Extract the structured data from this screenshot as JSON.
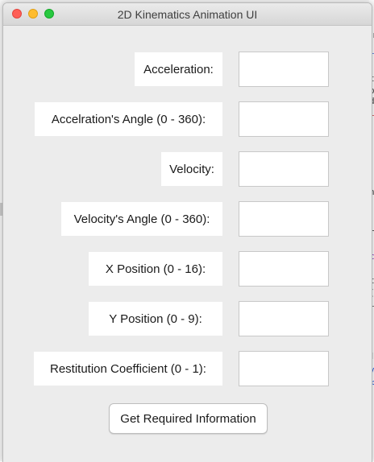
{
  "window": {
    "title": "2D Kinematics Animation UI"
  },
  "form": {
    "fields": [
      {
        "label": "Acceleration:",
        "value": ""
      },
      {
        "label": "Accelration's Angle (0 - 360):",
        "value": ""
      },
      {
        "label": "Velocity:",
        "value": ""
      },
      {
        "label": "Velocity's Angle (0 - 360):",
        "value": ""
      },
      {
        "label": "X Position (0 - 16):",
        "value": ""
      },
      {
        "label": "Y Position (0 - 9):",
        "value": ""
      },
      {
        "label": "Restitution Coefficient (0 - 1):",
        "value": ""
      }
    ],
    "submit_label": "Get Required Information"
  },
  "background_editor": {
    "fragments": [
      "er",
      "i",
      "t",
      "p",
      "d",
      "i",
      "n",
      "r",
      "c",
      "t",
      "(",
      "i",
      "M",
      "v",
      "<",
      "velo",
      "112"
    ]
  },
  "colors": {
    "window_bg": "#ececec",
    "close": "#fe5f57",
    "minimize": "#febc2e",
    "maximize": "#28c840"
  }
}
